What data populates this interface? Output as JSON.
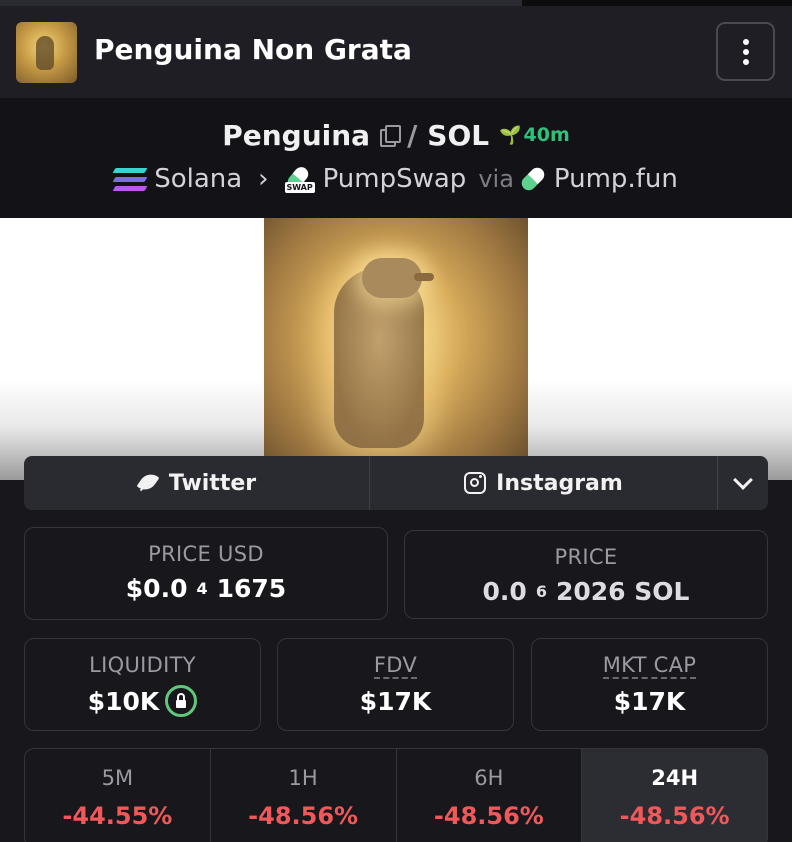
{
  "header": {
    "title": "Penguina Non Grata"
  },
  "pair": {
    "base": "Penguina",
    "separator": "/",
    "quote": "SOL",
    "age": "40m"
  },
  "chain": {
    "network": "Solana",
    "dex": "PumpSwap",
    "via_label": "via",
    "launchpad": "Pump.fun",
    "swap_tag": "SWAP"
  },
  "socials": {
    "twitter_label": "Twitter",
    "instagram_label": "Instagram"
  },
  "stats": {
    "price_usd": {
      "label": "PRICE USD",
      "prefix": "$0.0",
      "zeros": "4",
      "digits": "1675"
    },
    "price_sol": {
      "label": "PRICE",
      "prefix": "0.0",
      "zeros": "6",
      "digits": "2026 SOL"
    },
    "liquidity": {
      "label": "LIQUIDITY",
      "value": "$10K"
    },
    "fdv": {
      "label": "FDV",
      "value": "$17K"
    },
    "mkt_cap": {
      "label": "MKT CAP",
      "value": "$17K"
    }
  },
  "changes": [
    {
      "timeframe": "5M",
      "value": "-44.55%"
    },
    {
      "timeframe": "1H",
      "value": "-48.56%"
    },
    {
      "timeframe": "6H",
      "value": "-48.56%"
    },
    {
      "timeframe": "24H",
      "value": "-48.56%"
    }
  ],
  "colors": {
    "accent_green": "#2fc17a",
    "negative_red": "#f0585a",
    "lock_green": "#5fc97b"
  }
}
